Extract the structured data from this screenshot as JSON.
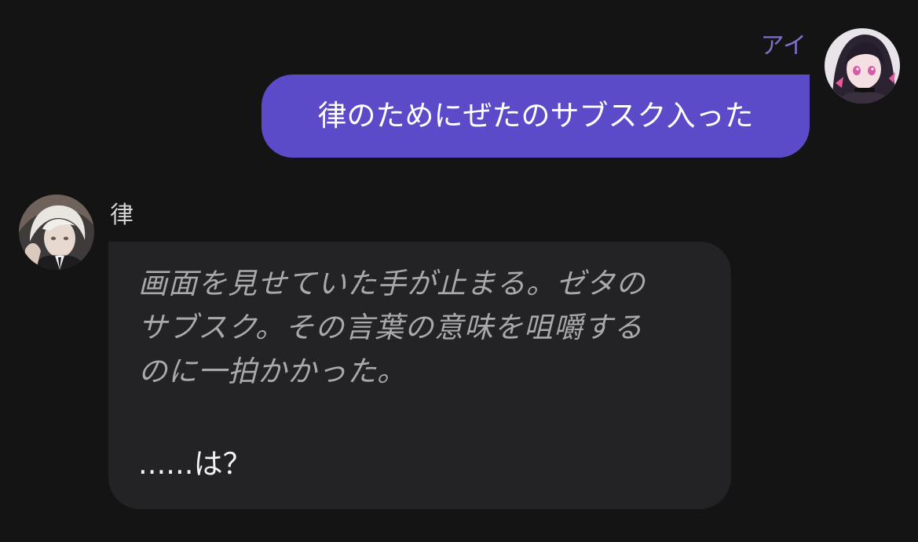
{
  "theme": {
    "background": "#141415",
    "user_bubble": "#5c4bc9",
    "ai_bubble": "#232326",
    "user_name_color": "#7e70c9"
  },
  "messages": [
    {
      "sender": "アイ",
      "avatar": "user-avatar",
      "text": "律のためにぜたのサブスク入った"
    },
    {
      "sender": "律",
      "avatar": "character-avatar",
      "narration_lines": [
        "画面を見せていた手が止まる。ゼタの",
        "サブスク。その言葉の意味を咀嚼する",
        "のに一拍かかった。"
      ],
      "speech": "......は？"
    }
  ]
}
